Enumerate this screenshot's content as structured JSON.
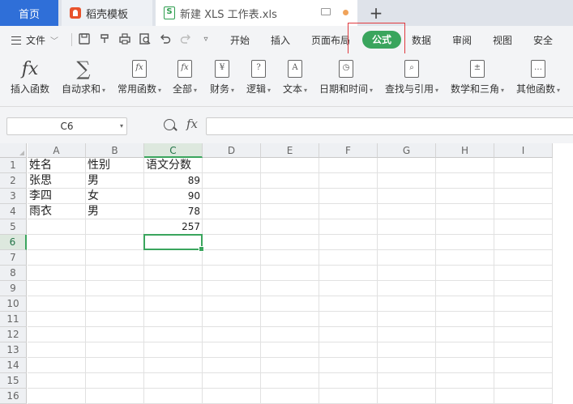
{
  "tabs": {
    "home": "首页",
    "docer": "稻壳模板",
    "file": "新建 XLS 工作表.xls",
    "xls_badge": "S"
  },
  "menu": {
    "file": "文件",
    "items": [
      "开始",
      "插入",
      "页面布局",
      "公式",
      "数据",
      "审阅",
      "视图",
      "安全"
    ],
    "active": "公式"
  },
  "ribbon": [
    {
      "icon": "fx-icon",
      "label": "插入函数",
      "dropdown": false
    },
    {
      "icon": "sigma-icon",
      "label": "自动求和",
      "dropdown": true
    },
    {
      "icon": "common-function-icon",
      "label": "常用函数",
      "dropdown": true
    },
    {
      "icon": "all-functions-icon",
      "label": "全部",
      "dropdown": true
    },
    {
      "icon": "finance-icon",
      "label": "财务",
      "dropdown": true
    },
    {
      "icon": "logic-icon",
      "label": "逻辑",
      "dropdown": true
    },
    {
      "icon": "text-icon",
      "label": "文本",
      "dropdown": true
    },
    {
      "icon": "datetime-icon",
      "label": "日期和时间",
      "dropdown": true
    },
    {
      "icon": "lookup-icon",
      "label": "查找与引用",
      "dropdown": true
    },
    {
      "icon": "math-icon",
      "label": "数学和三角",
      "dropdown": true
    },
    {
      "icon": "other-functions-icon",
      "label": "其他函数",
      "dropdown": true
    }
  ],
  "ribbon_glyphs": {
    "fx": "fx",
    "sigma": "∑",
    "common": "fx",
    "all": "fx",
    "finance": "¥",
    "logic": "?",
    "text": "A",
    "datetime": "◷",
    "lookup": "⌕",
    "math": "±",
    "other": "…"
  },
  "formula_bar": {
    "name_box": "C6",
    "fx": "fx",
    "content": ""
  },
  "sheet": {
    "columns": [
      "A",
      "B",
      "C",
      "D",
      "E",
      "F",
      "G",
      "H",
      "I"
    ],
    "rows": [
      "1",
      "2",
      "3",
      "4",
      "5",
      "6",
      "7",
      "8",
      "9",
      "10",
      "11",
      "12",
      "13",
      "14",
      "15",
      "16"
    ],
    "selected_column": "C",
    "selected_row": "6",
    "cells": {
      "A1": "姓名",
      "B1": "性别",
      "C1": "语文分数",
      "A2": "张思",
      "B2": "男",
      "C2": "89",
      "A3": "李四",
      "B3": "女",
      "C3": "90",
      "A4": "雨衣",
      "B4": "男",
      "C4": "78",
      "C5": "257"
    }
  },
  "colors": {
    "active_tab": "#2f6fd8",
    "accent_green": "#3aa55d",
    "highlight_red": "#e0393e"
  }
}
